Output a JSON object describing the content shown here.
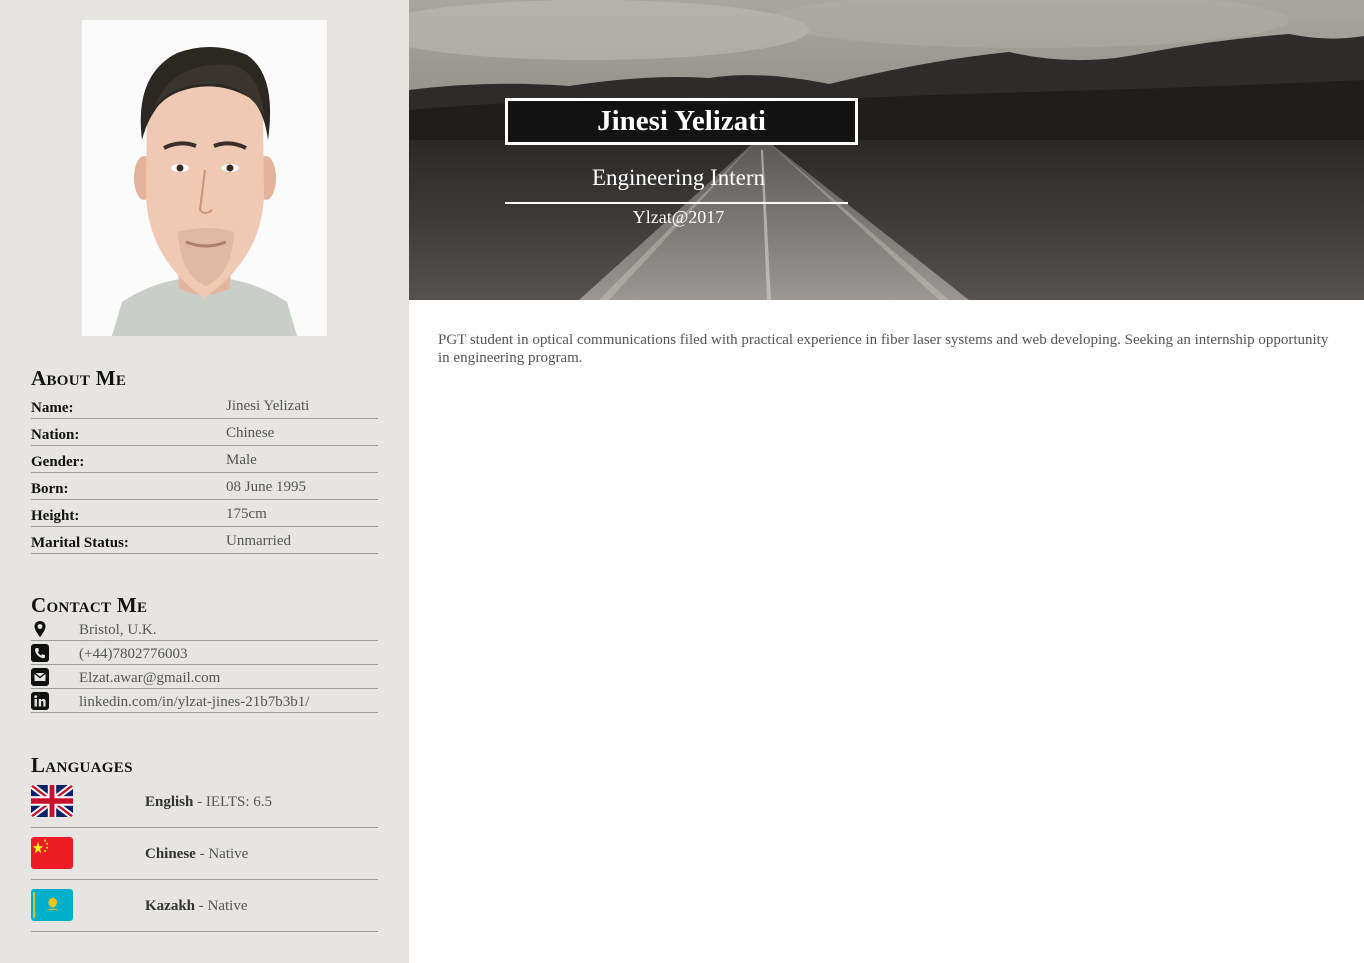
{
  "profile": {
    "name": "Jinesi Yelizati",
    "job_title": "Engineering Intern",
    "handle": "Ylzat@2017",
    "summary": "PGT student in optical communications filed with practical experience in fiber laser systems and web developing. Seeking an internship opportunity in engineering program."
  },
  "about": {
    "title": "About Me",
    "rows": [
      {
        "key": "Name:",
        "value": "Jinesi Yelizati"
      },
      {
        "key": "Nation:",
        "value": "Chinese"
      },
      {
        "key": "Gender:",
        "value": "Male"
      },
      {
        "key": "Born:",
        "value": "08 June 1995"
      },
      {
        "key": "Height:",
        "value": "175cm"
      },
      {
        "key": "Marital Status:",
        "value": "Unmarried"
      }
    ]
  },
  "contact": {
    "title": "Contact Me",
    "rows": [
      {
        "icon": "map-marker-icon",
        "value": "Bristol, U.K."
      },
      {
        "icon": "phone-icon",
        "value": "(+44)7802776003"
      },
      {
        "icon": "envelope-icon",
        "value": "Elzat.awar@gmail.com"
      },
      {
        "icon": "linkedin-icon",
        "value": "linkedin.com/in/ylzat-jines-21b7b3b1/"
      }
    ]
  },
  "languages": {
    "title": "Languages",
    "rows": [
      {
        "flag": "uk-flag-icon",
        "name": "English",
        "level": " - IELTS: 6.5"
      },
      {
        "flag": "china-flag-icon",
        "name": "Chinese",
        "level": " - Native"
      },
      {
        "flag": "kazakhstan-flag-icon",
        "name": "Kazakh",
        "level": " - Native"
      }
    ]
  },
  "colors": {
    "sidebar_bg": "#e6e5e1",
    "heading": "#111111",
    "body_text": "#555555"
  }
}
